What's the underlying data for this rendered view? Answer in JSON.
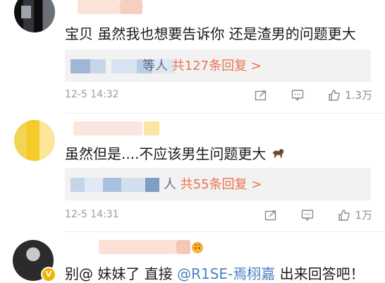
{
  "comments": [
    {
      "text": "宝贝  虽然我也想要告诉你  还是渣男的问题更大",
      "reply_prefix": "等人",
      "reply_summary": "共127条回复 >",
      "time": "12-5 14:32",
      "likes": "1.3万"
    },
    {
      "text": "虽然但是....不应该男生问题更大",
      "reply_prefix": "人",
      "reply_summary": "共55条回复 >",
      "time": "12-5 14:31",
      "likes": "1万"
    },
    {
      "text_parts": {
        "p1": "别@ 妹妹了 直接 ",
        "mention": "@R1SE-焉栩嘉",
        "p2": " 出来回答吧！"
      }
    }
  ],
  "icons": {
    "repost": "repost-icon",
    "comment": "comment-icon",
    "like": "thumbs-up-icon",
    "horse": "horse-emoji",
    "verified": "verified-badge"
  }
}
